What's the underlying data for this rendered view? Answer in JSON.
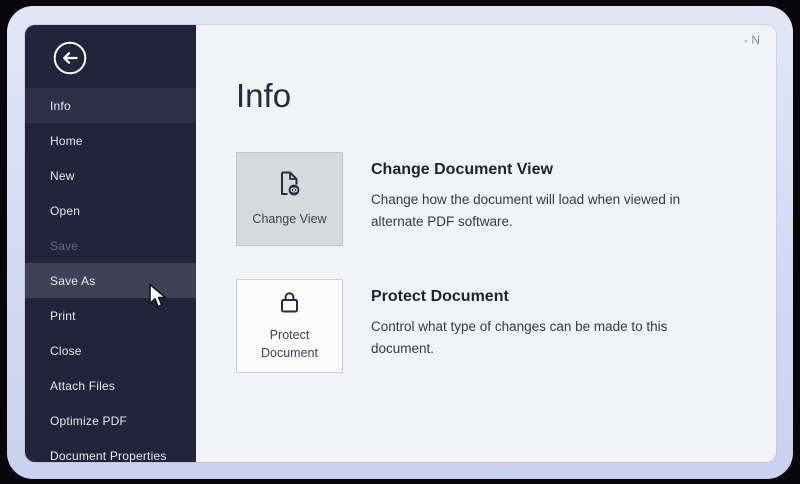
{
  "window": {
    "title_fragment": "- N"
  },
  "sidebar": {
    "back_button_icon": "back-arrow-circle-icon",
    "items": [
      {
        "label": "Info",
        "state": "active"
      },
      {
        "label": "Home",
        "state": "normal"
      },
      {
        "label": "New",
        "state": "normal"
      },
      {
        "label": "Open",
        "state": "normal"
      },
      {
        "label": "Save",
        "state": "disabled"
      },
      {
        "label": "Save As",
        "state": "hover"
      },
      {
        "label": "Print",
        "state": "normal"
      },
      {
        "label": "Close",
        "state": "normal"
      },
      {
        "label": "Attach Files",
        "state": "normal"
      },
      {
        "label": "Optimize PDF",
        "state": "normal"
      },
      {
        "label": "Document Properties",
        "state": "normal"
      }
    ]
  },
  "content": {
    "page_title": "Info",
    "sections": [
      {
        "button_label": "Change View",
        "button_state": "highlighted",
        "icon": "document-view-icon",
        "heading": "Change Document View",
        "description": "Change how the document will load when viewed in alternate PDF software."
      },
      {
        "button_label": "Protect Document",
        "button_state": "normal",
        "icon": "lock-icon",
        "heading": "Protect Document",
        "description": "Control what type of changes can be made to this document."
      }
    ]
  },
  "cursor": {
    "icon": "arrow-pointer-icon",
    "over": "Save As"
  },
  "colors": {
    "sidebar_bg": "#23243b",
    "sidebar_item_active_bg": "#2f3048",
    "sidebar_item_hover_bg": "#3f4156",
    "sidebar_text": "#e9e9f0",
    "sidebar_text_disabled": "#686a7e",
    "content_bg": "#f2f3f6",
    "heading_text": "#1f2138",
    "tile_highlighted_bg": "#d8d9db",
    "tile_normal_bg": "#fcfcfd",
    "halo": "#d4dbf2"
  }
}
